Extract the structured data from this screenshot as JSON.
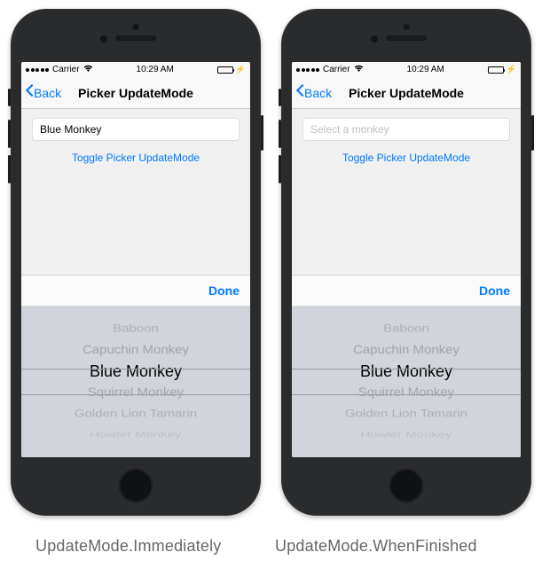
{
  "status": {
    "carrier": "Carrier",
    "time": "10:29 AM"
  },
  "nav": {
    "back": "Back",
    "title": "Picker UpdateMode"
  },
  "left": {
    "field_value": "Blue Monkey"
  },
  "right": {
    "field_placeholder": "Select a monkey"
  },
  "toggle_label": "Toggle Picker UpdateMode",
  "done_label": "Done",
  "picker": {
    "items": [
      "Baboon",
      "Capuchin Monkey",
      "Blue Monkey",
      "Squirrel Monkey",
      "Golden Lion Tamarin",
      "Howler Monkey"
    ],
    "selected_index": 2
  },
  "captions": {
    "left": "UpdateMode.Immediately",
    "right": "UpdateMode.WhenFinished"
  }
}
